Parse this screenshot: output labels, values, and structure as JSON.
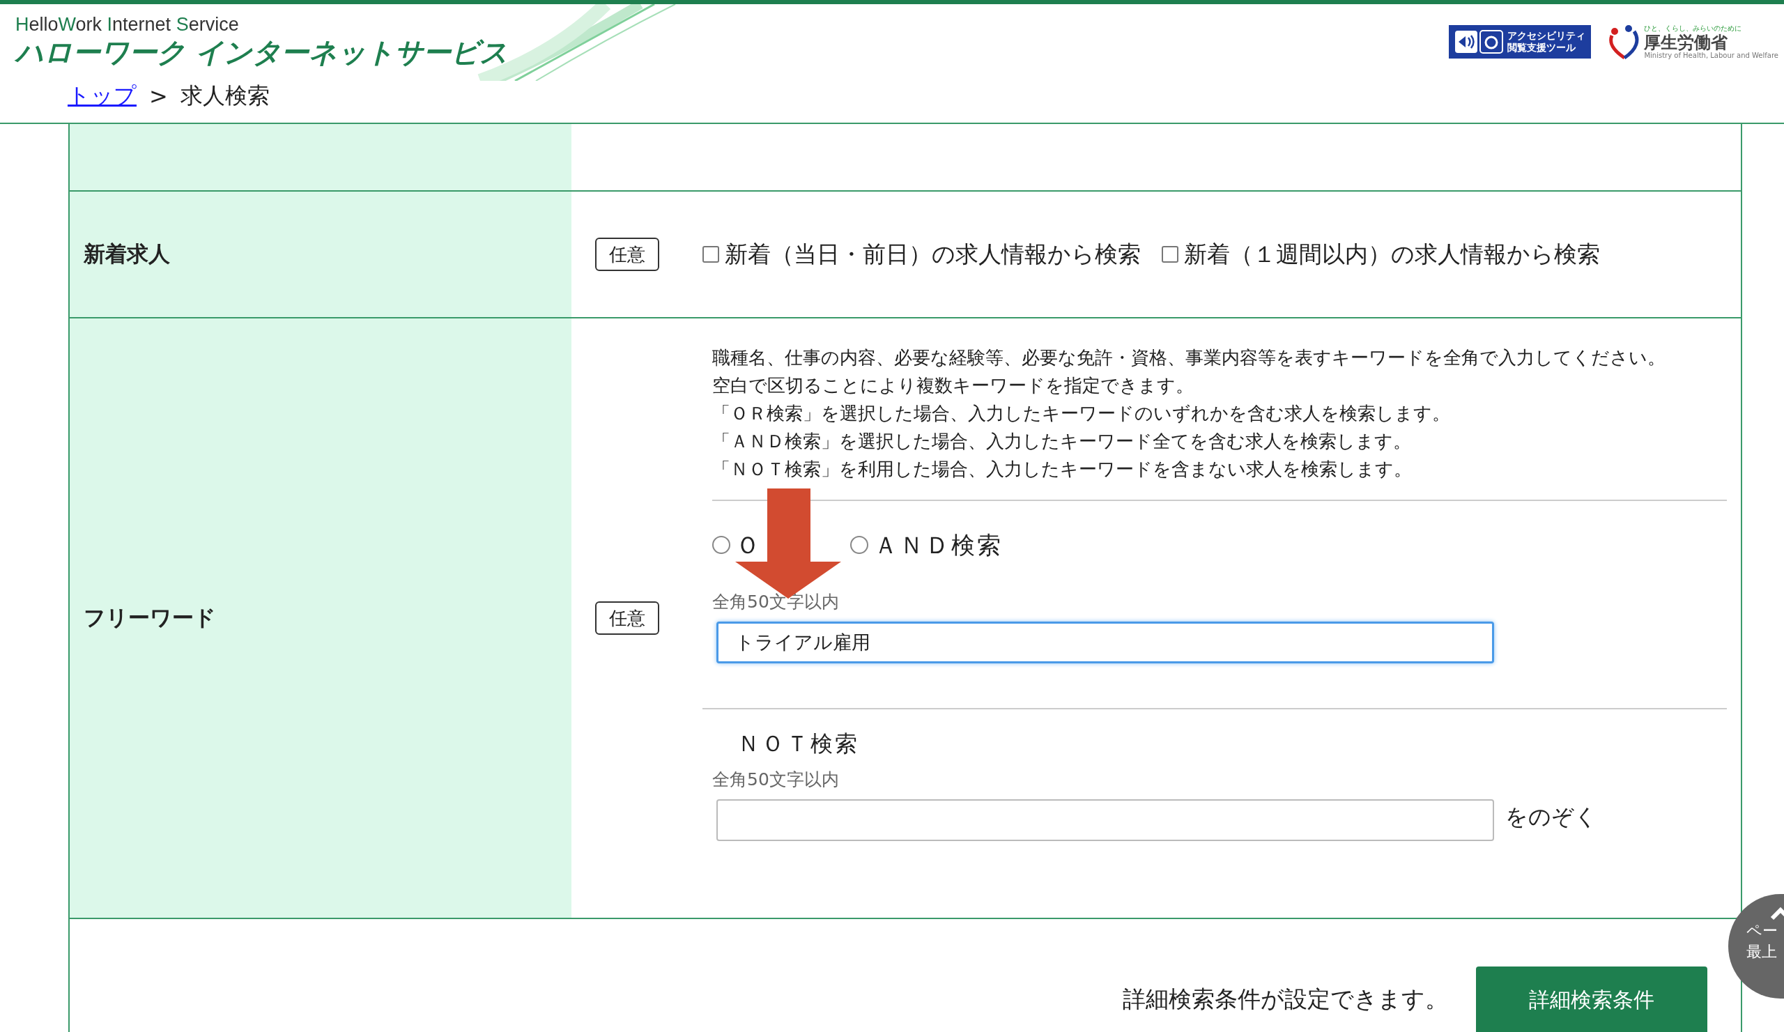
{
  "header": {
    "subtitle_parts": [
      {
        "text": "H",
        "accent": true
      },
      {
        "text": "ello",
        "accent": false
      },
      {
        "text": "W",
        "accent": true
      },
      {
        "text": "ork ",
        "accent": false
      },
      {
        "text": "I",
        "accent": true
      },
      {
        "text": "nternet ",
        "accent": false
      },
      {
        "text": "S",
        "accent": true
      },
      {
        "text": "ervice",
        "accent": false
      }
    ],
    "title": "ハローワーク インターネットサービス",
    "accessibility_logo": {
      "line1": "アクセシビリティ",
      "line2": "閲覧支援ツール"
    },
    "ministry_logo": {
      "tagline": "ひと、くらし、みらいのために",
      "name": "厚生労働省",
      "english": "Ministry of Health, Labour and Welfare"
    }
  },
  "breadcrumb": [
    {
      "label": "トップ",
      "kind": "link"
    },
    {
      "label": ">",
      "kind": "separator"
    },
    {
      "label": "求人検索",
      "kind": "current"
    }
  ],
  "form_rows": [
    {
      "kind": "checkboxes",
      "label": "新着求人",
      "badge": "任意",
      "options": [
        {
          "label": "新着（当日・前日）の求人情報から検索",
          "checked": false
        },
        {
          "label": "新着（１週間以内）の求人情報から検索",
          "checked": false
        }
      ]
    },
    {
      "kind": "freeword",
      "label": "フリーワード",
      "badge": "任意",
      "description": [
        "職種名、仕事の内容、必要な経験等、必要な免許・資格、事業内容等を表すキーワードを全角で入力してください。",
        "空白で区切ることにより複数キーワードを指定できます。",
        "「ＯＲ検索」を選択した場合、入力したキーワードのいずれかを含む求人を検索します。",
        "「ＡＮＤ検索」を選択した場合、入力したキーワード全てを含む求人を検索します。",
        "「ＮＯＴ検索」を利用した場合、入力したキーワードを含まない求人を検索します。"
      ],
      "match_options": [
        {
          "label": "Ｏ",
          "selected": false
        },
        {
          "label": "ＡＮＤ検索",
          "selected": false
        }
      ],
      "keyword": {
        "hint": "全角50文字以内",
        "value": "トライアル雇用",
        "focused": true
      },
      "not_search": {
        "title": "ＮＯＴ検索",
        "hint": "全角50文字以内",
        "suffix": "をのぞく",
        "focused": false
      }
    }
  ],
  "detail": {
    "text": "詳細検索条件が設定できます。",
    "button": "詳細検索条件"
  },
  "page_top": {
    "line1": "ペー",
    "line2": "最上"
  },
  "annotation": {
    "kind": "arrow"
  }
}
